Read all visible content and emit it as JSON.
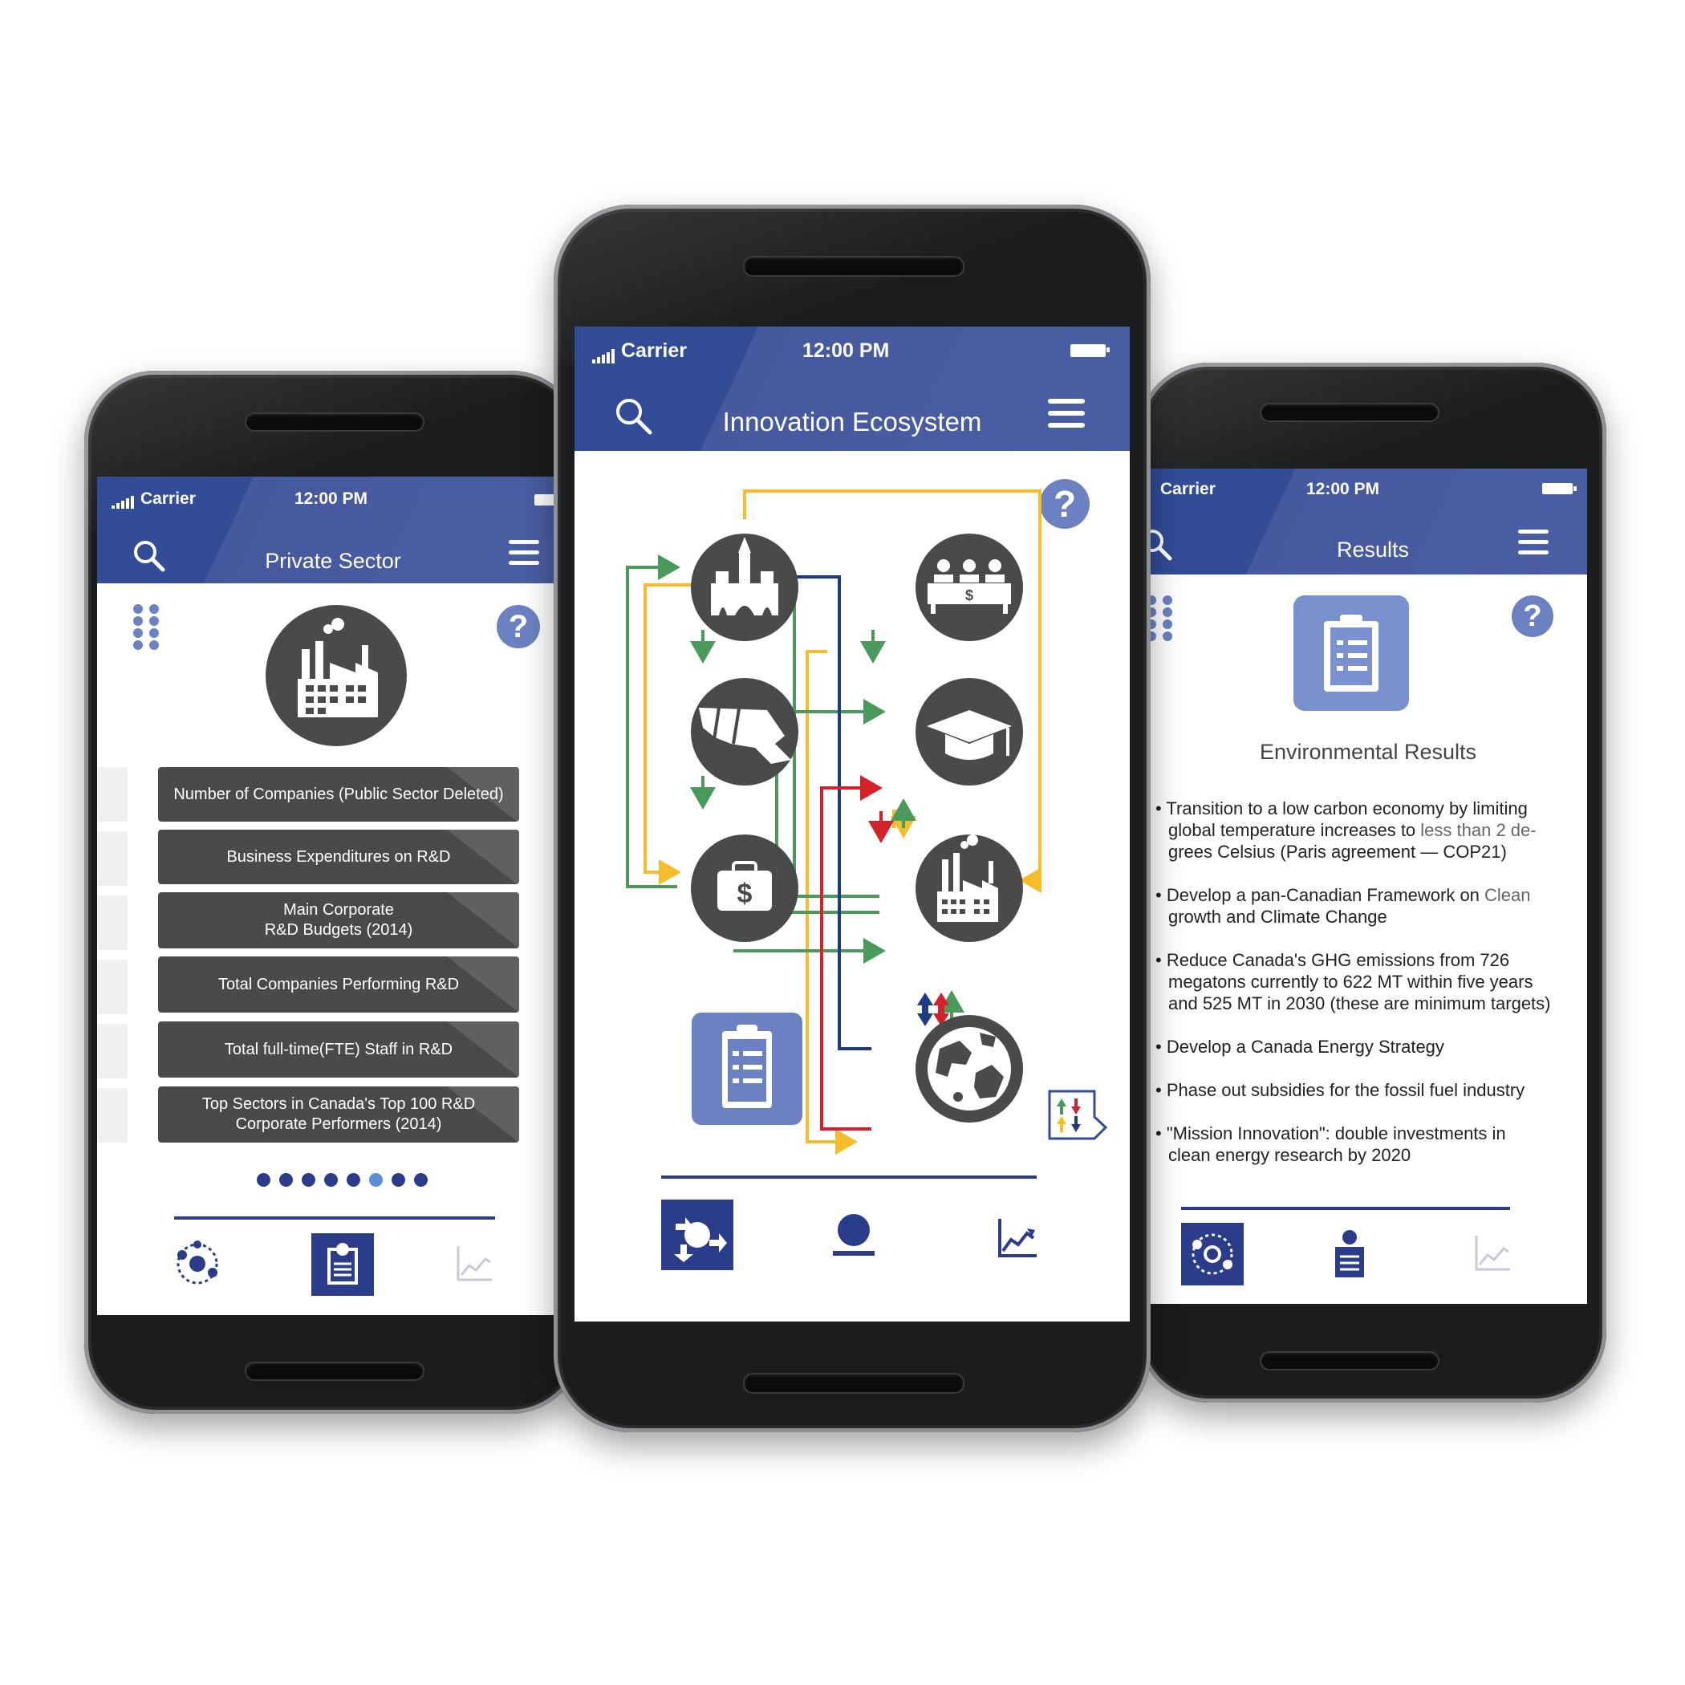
{
  "status": {
    "carrier": "Carrier",
    "time": "12:00 PM"
  },
  "left": {
    "title": "Private Sector",
    "help": "?",
    "items": [
      "Number of Companies (Public Sector Deleted)",
      "Business Expenditures on R&D",
      "Main Corporate\nR&D Budgets (2014)",
      "Total Companies Performing R&D",
      "Total full-time(FTE) Staff in R&D",
      "Top Sectors in Canada's Top 100 R&D Corporate Performers (2014)"
    ],
    "page_dots": {
      "count": 8,
      "active": 6
    }
  },
  "center": {
    "title": "Innovation Ecosystem",
    "help": "?",
    "nodes": [
      "government-icon",
      "funding-board-icon",
      "canada-map-icon",
      "university-icon",
      "money-bag-icon",
      "factory-icon",
      "globe-icon",
      "clipboard-icon",
      "exchange-legend-icon"
    ]
  },
  "right": {
    "title": "Results",
    "help": "?",
    "heading": "Environmental Results",
    "bullets": [
      {
        "text": "Transition to a low carbon economy by limiting",
        "muted": ""
      },
      {
        "text": "global temperature increases to ",
        "muted": "less than 2 de-"
      },
      {
        "text": "grees Celsius (Paris agreement — COP21)",
        "muted": ""
      },
      {
        "text": "Develop a pan-Canadian Framework on ",
        "muted": "Clean"
      },
      {
        "text": "growth and Climate Change",
        "muted": ""
      },
      {
        "text": "Reduce Canada's GHG emissions from 726",
        "muted": ""
      },
      {
        "text": "megatons currently to 622 MT within five years",
        "muted": ""
      },
      {
        "text": "and 525 MT in 2030 (these are minimum targets)",
        "muted": ""
      },
      {
        "text": "Develop a Canada Energy Strategy",
        "muted": ""
      },
      {
        "text": "Phase out subsidies for the fossil fuel industry",
        "muted": ""
      },
      {
        "text": "\"Mission Innovation\": double investments in",
        "muted": ""
      },
      {
        "text": "clean energy research by 2020",
        "muted": ""
      }
    ]
  },
  "colors": {
    "brand": "#324c97",
    "accent": "#6b81c1",
    "green": "#4a9a5c",
    "yellow": "#f5bd2a",
    "red": "#d4212a",
    "navy": "#1d3a86",
    "node": "#4a4a4a"
  }
}
